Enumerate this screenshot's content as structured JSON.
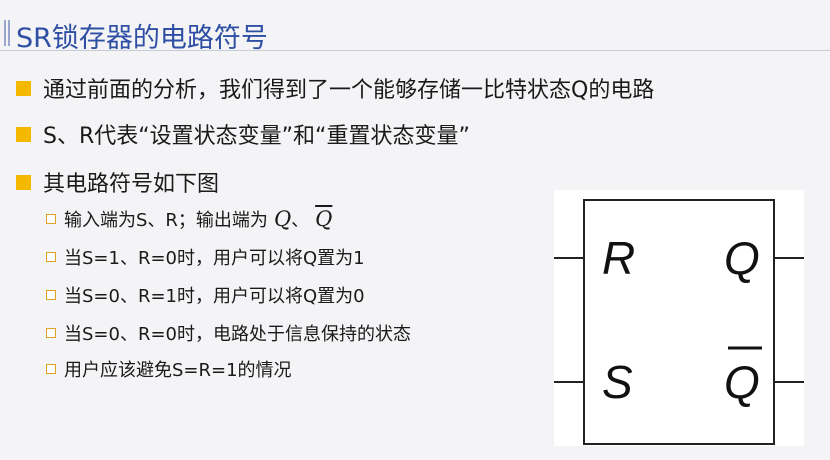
{
  "title": "SR锁存器的电路符号",
  "bullets": [
    "通过前面的分析，我们得到了一个能够存储一比特状态Q的电路",
    "S、R代表“设置状态变量”和“重置状态变量”",
    "其电路符号如下图"
  ],
  "sub_bullets": {
    "item0_text": "输入端为S、R；输出端为",
    "item0_q": "Q",
    "item0_sep": "、",
    "item0_qbar": "Q",
    "item1": "当S=1、R=0时，用户可以将Q置为1",
    "item2": "当S=0、R=1时，用户可以将Q置为0",
    "item3": "当S=0、R=0时，电路处于信息保持的状态",
    "item4": "用户应该避免S=R=1的情况"
  },
  "symbol": {
    "label_r": "R",
    "label_s": "S",
    "label_q": "Q",
    "label_qbar": "Q"
  },
  "colors": {
    "title": "#2f4fa5",
    "bullet_square": "#f5b800",
    "sub_box": "#e0a020"
  }
}
